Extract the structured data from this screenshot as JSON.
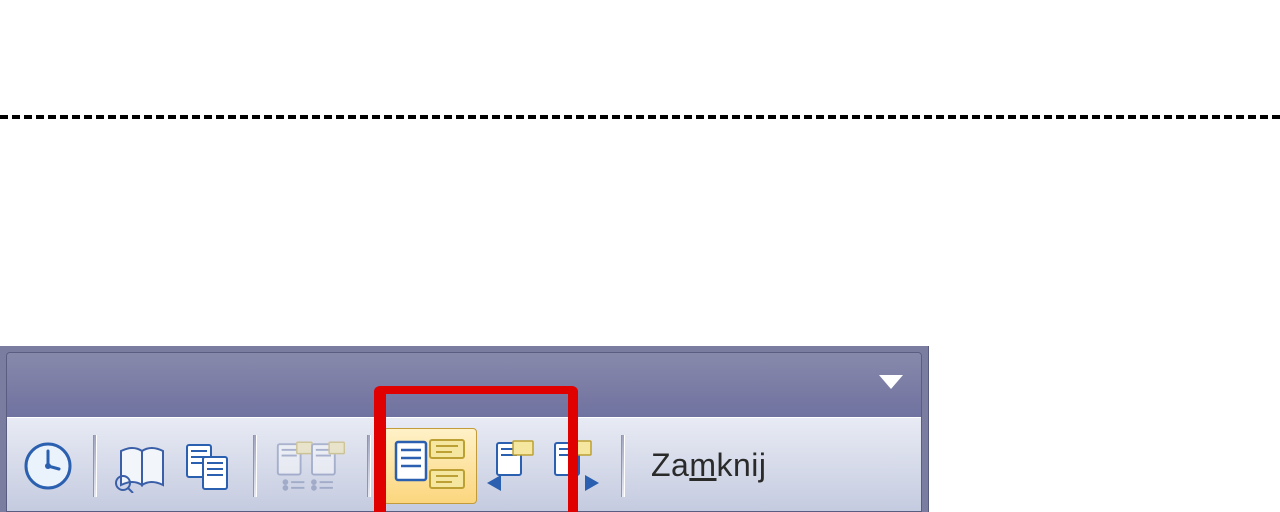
{
  "toolbar": {
    "close_label_pre": "Za",
    "close_label_ul": "m",
    "close_label_post": "knij",
    "buttons": {
      "clock": "clock-icon",
      "open_book": "open-book-icon",
      "two_pages": "two-pages-icon",
      "two_pages_list": "two-pages-list-icon",
      "callouts_stack": "callouts-stack-icon",
      "callout_prev": "callout-previous-icon",
      "callout_next": "callout-next-icon"
    }
  }
}
